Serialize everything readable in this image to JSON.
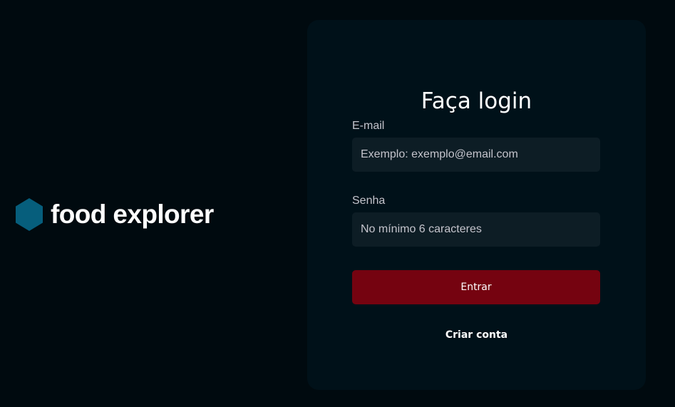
{
  "brand": {
    "icon": "hexagon-icon",
    "name": "food explorer",
    "color": "#065E7C"
  },
  "login": {
    "title": "Faça login",
    "email_label": "E-mail",
    "email_placeholder": "Exemplo: exemplo@email.com",
    "email_value": "",
    "password_label": "Senha",
    "password_placeholder": "No mínimo 6 caracteres",
    "password_value": "",
    "submit_label": "Entrar",
    "create_account_label": "Criar conta"
  },
  "colors": {
    "background": "#000A0F",
    "card": "#001119",
    "input": "#0D1D25",
    "button": "#750310",
    "label": "#C4C4CC"
  }
}
